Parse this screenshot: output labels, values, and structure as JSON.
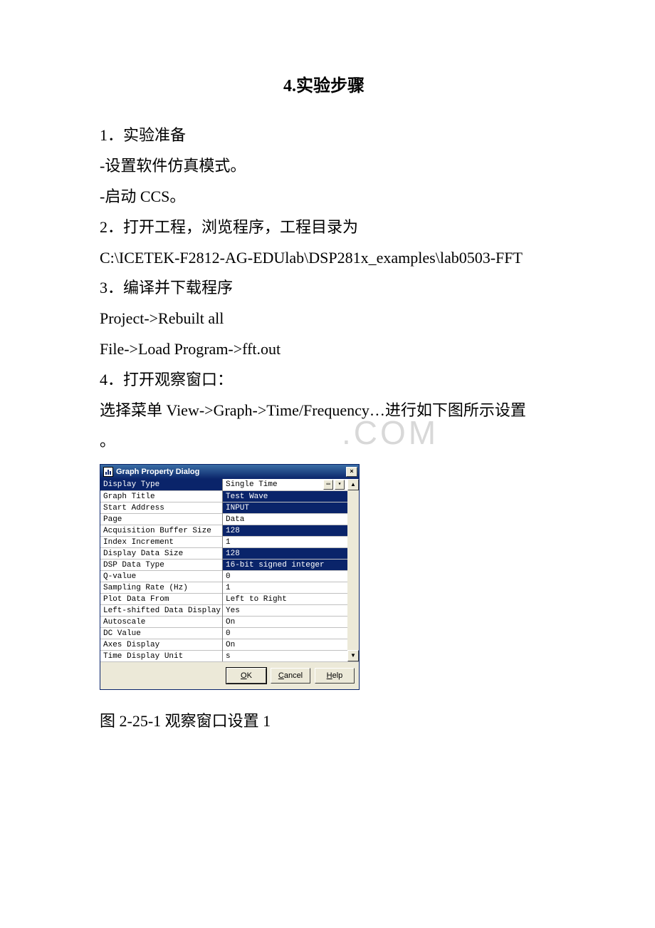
{
  "heading": "4.实验步骤",
  "paragraphs": {
    "p1": "1．实验准备",
    "p2": "-设置软件仿真模式。",
    "p3": "-启动 CCS。",
    "p4": "2．打开工程，浏览程序，工程目录为",
    "p5": "C:\\ICETEK-F2812-AG-EDUlab\\DSP281x_examples\\lab0503-FFT",
    "p6": "3．编译并下载程序",
    "p7": " Project->Rebuilt all",
    "p8": " File->Load Program->fft.out",
    "p9": "4．打开观察窗口：",
    "p10": "选择菜单 View->Graph->Time/Frequency…进行如下图所示设置",
    "p11": "。"
  },
  "watermark": ".COM",
  "dialog": {
    "title": "Graph Property Dialog",
    "close_glyph": "×",
    "rows": [
      {
        "label": "Display Type",
        "value": "Single Time",
        "highlighted": false,
        "hasDropdown": true
      },
      {
        "label": "Graph Title",
        "value": "Test Wave",
        "highlighted": true
      },
      {
        "label": "Start Address",
        "value": "INPUT",
        "highlighted": true
      },
      {
        "label": "Page",
        "value": "Data",
        "highlighted": false
      },
      {
        "label": "Acquisition Buffer Size",
        "value": "128",
        "highlighted": true
      },
      {
        "label": "Index Increment",
        "value": "1",
        "highlighted": false
      },
      {
        "label": "Display Data Size",
        "value": "128",
        "highlighted": true
      },
      {
        "label": "DSP Data Type",
        "value": "16-bit signed integer",
        "highlighted": true
      },
      {
        "label": "Q-value",
        "value": "0",
        "highlighted": false
      },
      {
        "label": "Sampling Rate (Hz)",
        "value": "1",
        "highlighted": false
      },
      {
        "label": "Plot Data From",
        "value": "Left to Right",
        "highlighted": false
      },
      {
        "label": "Left-shifted Data Display",
        "value": "Yes",
        "highlighted": false
      },
      {
        "label": "Autoscale",
        "value": "On",
        "highlighted": false
      },
      {
        "label": "DC Value",
        "value": "0",
        "highlighted": false
      },
      {
        "label": "Axes Display",
        "value": "On",
        "highlighted": false
      },
      {
        "label": "Time Display Unit",
        "value": "s",
        "highlighted": false
      }
    ],
    "buttons": {
      "ok": "OK",
      "cancel": "Cancel",
      "help": "Help"
    },
    "scroll": {
      "up": "▲",
      "down": "▼"
    },
    "dropdown_glyph": "▾",
    "ellipsis_glyph": "▭"
  },
  "caption": "图 2-25-1 观察窗口设置 1"
}
